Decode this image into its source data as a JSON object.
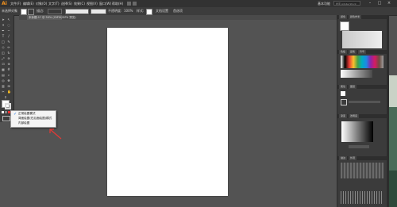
{
  "app": {
    "logo": "Ai",
    "brand_color": "#f7941d"
  },
  "menus": [
    "文件(F)",
    "编辑(E)",
    "对象(O)",
    "文字(T)",
    "选择(S)",
    "效果(C)",
    "视图(V)",
    "窗口(W)",
    "帮助(H)"
  ],
  "menu_right": {
    "workspace": "基本功能",
    "search_placeholder": "搜索 Adobe Stock"
  },
  "window_controls": [
    "minimize",
    "restore",
    "close"
  ],
  "control_bar": {
    "selection_label": "未选择对象",
    "stroke_label": "描边:",
    "stroke_value": "",
    "opacity_label": "不透明度:",
    "opacity_value": "100%",
    "style_label": "样式:",
    "doc_settings": "文档设置",
    "preferences": "首选项"
  },
  "document_tab": {
    "label": "未标题-1* @ 50% (CMYK/GPU 预览)",
    "close": "×"
  },
  "context_menu": {
    "items": [
      {
        "label": "正常绘图模式",
        "checked": true
      },
      {
        "label": "背面绘图(在后面绘图)模式",
        "checked": false
      },
      {
        "label": "内部绘图",
        "checked": false
      }
    ]
  },
  "panels": {
    "top_tabs": [
      "颜色",
      "颜色参考"
    ],
    "swatches_tabs": [
      "色板",
      "画笔",
      "符号"
    ],
    "properties_tabs": [
      "属性",
      "图层"
    ],
    "gradient_tabs": [
      "渐变",
      "透明度"
    ],
    "bottom_tabs": [
      "描边",
      "外观"
    ]
  },
  "colors": {
    "bg_canvas": "#535353",
    "artboard": "#ffffff",
    "menu_bg": "#323232",
    "panel_bg": "#3b3b3b",
    "arrow": "#e53935"
  }
}
